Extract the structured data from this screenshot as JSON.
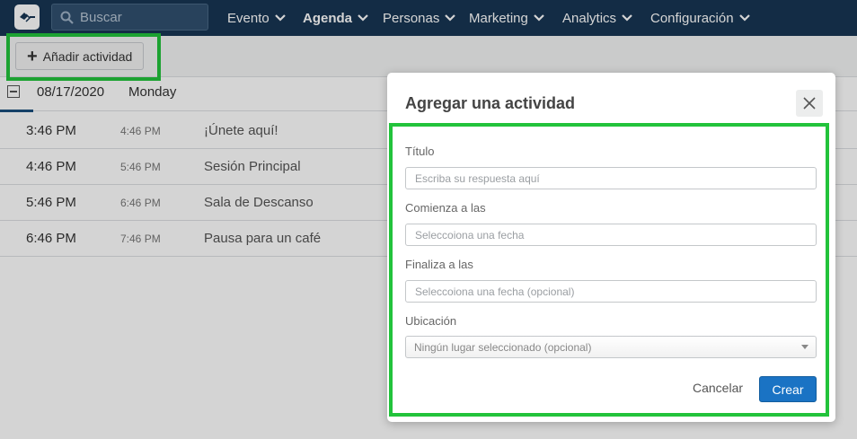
{
  "nav": {
    "logo_icon": "app-logo",
    "search_placeholder": "Buscar",
    "items": [
      {
        "label": "Evento",
        "active": false
      },
      {
        "label": "Agenda",
        "active": true
      },
      {
        "label": "Personas",
        "active": false
      },
      {
        "label": "Marketing",
        "active": false
      },
      {
        "label": "Analytics",
        "active": false
      },
      {
        "label": "Configuración",
        "active": false
      }
    ]
  },
  "toolbar": {
    "add_label": "Añadir actividad"
  },
  "agenda": {
    "date": "08/17/2020",
    "day": "Monday",
    "activities": [
      {
        "start": "3:46 PM",
        "end": "4:46 PM",
        "title": "¡Únete aquí!"
      },
      {
        "start": "4:46 PM",
        "end": "5:46 PM",
        "title": "Sesión Principal"
      },
      {
        "start": "5:46 PM",
        "end": "6:46 PM",
        "title": "Sala de Descanso"
      },
      {
        "start": "6:46 PM",
        "end": "7:46 PM",
        "title": "Pausa para un café"
      }
    ]
  },
  "modal": {
    "title": "Agregar una actividad",
    "fields": {
      "title_label": "Título",
      "title_placeholder": "Escriba su respuesta aquí",
      "start_label": "Comienza a las",
      "start_placeholder": "Seleccoiona una fecha",
      "end_label": "Finaliza a las",
      "end_placeholder": "Seleccoiona una fecha (opcional)",
      "location_label": "Ubicación",
      "location_value": "Ningún lugar seleccionado (opcional)"
    },
    "cancel_label": "Cancelar",
    "create_label": "Crear"
  },
  "colors": {
    "nav_bg": "#183654",
    "highlight": "#22c33b",
    "primary_button": "#1a73c4"
  }
}
